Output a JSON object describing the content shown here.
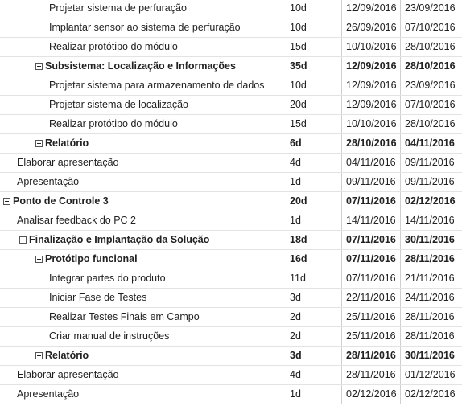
{
  "rows": [
    {
      "name": "Projetar sistema de perfuração",
      "duration": "10d",
      "start": "12/09/2016",
      "end": "23/09/2016",
      "level": 3,
      "summary": false
    },
    {
      "name": "Implantar sensor ao sistema de perfuração",
      "duration": "10d",
      "start": "26/09/2016",
      "end": "07/10/2016",
      "level": 3,
      "summary": false
    },
    {
      "name": "Realizar protótipo do módulo",
      "duration": "15d",
      "start": "10/10/2016",
      "end": "28/10/2016",
      "level": 3,
      "summary": false
    },
    {
      "name": "Subsistema: Localização e Informações",
      "duration": "35d",
      "start": "12/09/2016",
      "end": "28/10/2016",
      "level": 2,
      "summary": true,
      "toggle": "minus"
    },
    {
      "name": "Projetar sistema para armazenamento de dados",
      "duration": "10d",
      "start": "12/09/2016",
      "end": "23/09/2016",
      "level": 3,
      "summary": false
    },
    {
      "name": "Projetar sistema de localização",
      "duration": "20d",
      "start": "12/09/2016",
      "end": "07/10/2016",
      "level": 3,
      "summary": false
    },
    {
      "name": "Realizar protótipo do módulo",
      "duration": "15d",
      "start": "10/10/2016",
      "end": "28/10/2016",
      "level": 3,
      "summary": false
    },
    {
      "name": "Relatório",
      "duration": "6d",
      "start": "28/10/2016",
      "end": "04/11/2016",
      "level": 2,
      "summary": true,
      "toggle": "plus"
    },
    {
      "name": "Elaborar apresentação",
      "duration": "4d",
      "start": "04/11/2016",
      "end": "09/11/2016",
      "level": 1,
      "summary": false
    },
    {
      "name": "Apresentação",
      "duration": "1d",
      "start": "09/11/2016",
      "end": "09/11/2016",
      "level": 1,
      "summary": false
    },
    {
      "name": "Ponto de Controle 3",
      "duration": "20d",
      "start": "07/11/2016",
      "end": "02/12/2016",
      "level": 0,
      "summary": true,
      "toggle": "minus"
    },
    {
      "name": "Analisar feedback do PC 2",
      "duration": "1d",
      "start": "14/11/2016",
      "end": "14/11/2016",
      "level": 1,
      "summary": false
    },
    {
      "name": "Finalização e Implantação da Solução",
      "duration": "18d",
      "start": "07/11/2016",
      "end": "30/11/2016",
      "level": 1,
      "summary": true,
      "toggle": "minus"
    },
    {
      "name": "Protótipo funcional",
      "duration": "16d",
      "start": "07/11/2016",
      "end": "28/11/2016",
      "level": 2,
      "summary": true,
      "toggle": "minus"
    },
    {
      "name": "Integrar partes do produto",
      "duration": "11d",
      "start": "07/11/2016",
      "end": "21/11/2016",
      "level": 3,
      "summary": false
    },
    {
      "name": "Iniciar Fase de Testes",
      "duration": "3d",
      "start": "22/11/2016",
      "end": "24/11/2016",
      "level": 3,
      "summary": false
    },
    {
      "name": "Realizar Testes Finais em Campo",
      "duration": "2d",
      "start": "25/11/2016",
      "end": "28/11/2016",
      "level": 3,
      "summary": false
    },
    {
      "name": "Criar manual de instruções",
      "duration": "2d",
      "start": "25/11/2016",
      "end": "28/11/2016",
      "level": 3,
      "summary": false
    },
    {
      "name": "Relatório",
      "duration": "3d",
      "start": "28/11/2016",
      "end": "30/11/2016",
      "level": 2,
      "summary": true,
      "toggle": "plus"
    },
    {
      "name": "Elaborar apresentação",
      "duration": "4d",
      "start": "28/11/2016",
      "end": "01/12/2016",
      "level": 1,
      "summary": false
    },
    {
      "name": "Apresentação",
      "duration": "1d",
      "start": "02/12/2016",
      "end": "02/12/2016",
      "level": 1,
      "summary": false
    }
  ]
}
